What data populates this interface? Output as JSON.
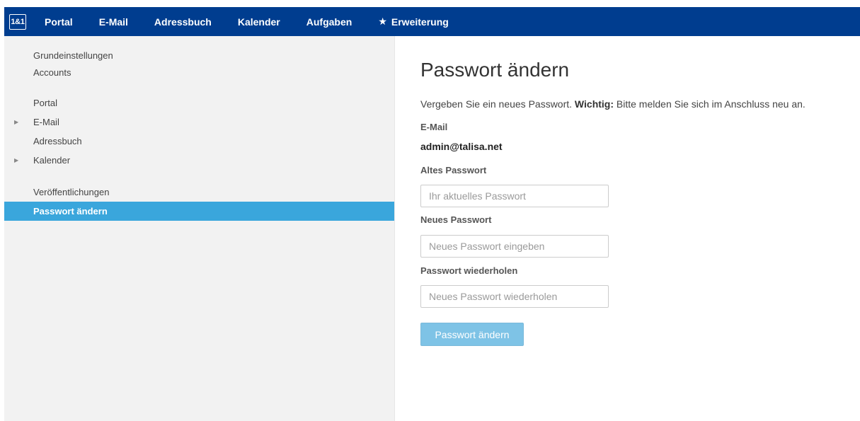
{
  "topbar": {
    "logo": "1&1",
    "nav": [
      {
        "label": "Portal"
      },
      {
        "label": "E-Mail"
      },
      {
        "label": "Adressbuch"
      },
      {
        "label": "Kalender"
      },
      {
        "label": "Aufgaben"
      },
      {
        "label": "Erweiterung",
        "icon": "star-icon",
        "icon_glyph": "★"
      }
    ],
    "background": "#003d8f"
  },
  "sidebar": {
    "items": [
      {
        "label": "Grundeinstellungen",
        "expandable": false
      },
      {
        "label": "Accounts",
        "expandable": false
      },
      {
        "label": "Portal",
        "expandable": false
      },
      {
        "label": "E-Mail",
        "expandable": true
      },
      {
        "label": "Adressbuch",
        "expandable": false
      },
      {
        "label": "Kalender",
        "expandable": true
      },
      {
        "label": "Veröffentlichungen",
        "expandable": false
      },
      {
        "label": "Passwort ändern",
        "expandable": false,
        "active": true
      }
    ],
    "caret_glyph": "▶",
    "active_color": "#3aa6dc"
  },
  "main": {
    "title": "Passwort ändern",
    "description": {
      "text": "Vergeben Sie ein neues Passwort.",
      "bold": "Wichtig:",
      "text_after": "Bitte melden Sie sich im Anschluss neu an."
    },
    "email": {
      "label": "E-Mail",
      "value": "admin@talisa.net"
    },
    "old_password": {
      "label": "Altes Passwort",
      "placeholder": "Ihr aktuelles Passwort",
      "value": ""
    },
    "new_password": {
      "label": "Neues Passwort",
      "placeholder": "Neues Passwort eingeben",
      "value": ""
    },
    "repeat_password": {
      "label": "Passwort wiederholen",
      "placeholder": "Neues Passwort wiederholen",
      "value": ""
    },
    "submit_label": "Passwort ändern",
    "submit_color": "#7ec3e6"
  }
}
